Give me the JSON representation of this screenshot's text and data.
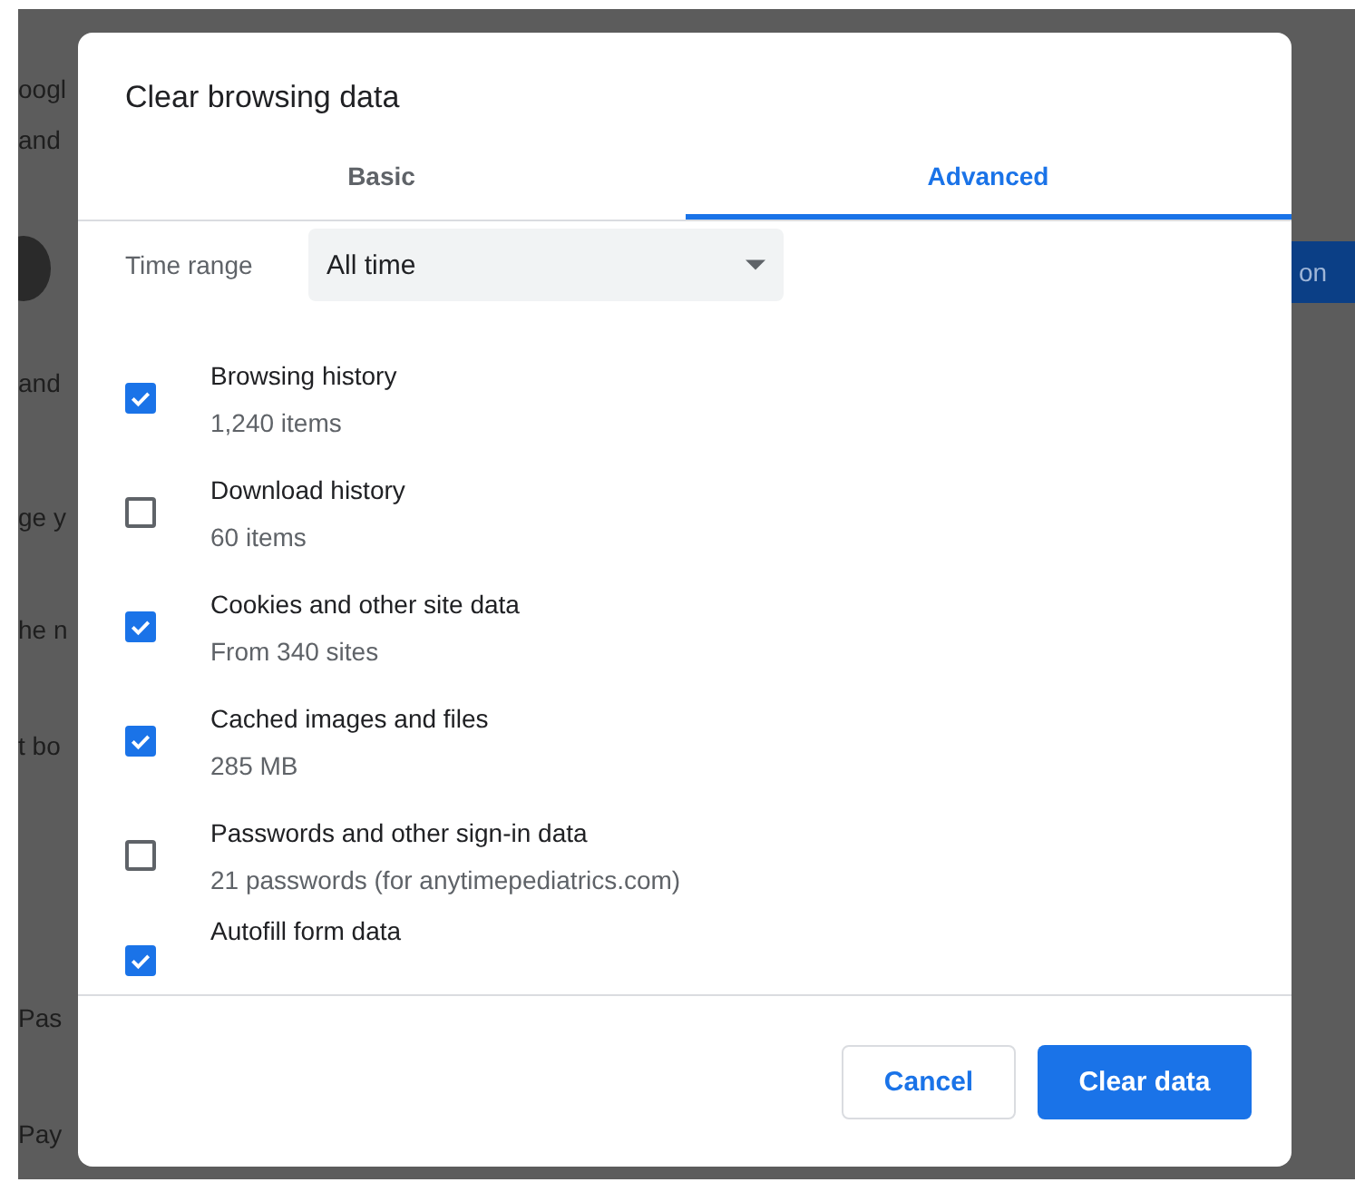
{
  "background": {
    "left_fragments": [
      "oogl",
      "and",
      "and",
      "ge y",
      "he n",
      "t bo",
      "Pas",
      "Pay"
    ],
    "right_button": "on"
  },
  "dialog": {
    "title": "Clear browsing data",
    "tabs": [
      {
        "label": "Basic",
        "selected": false
      },
      {
        "label": "Advanced",
        "selected": true
      }
    ],
    "time_range": {
      "label": "Time range",
      "value": "All time"
    },
    "items": [
      {
        "label": "Browsing history",
        "detail": "1,240 items",
        "checked": true
      },
      {
        "label": "Download history",
        "detail": "60 items",
        "checked": false
      },
      {
        "label": "Cookies and other site data",
        "detail": "From 340 sites",
        "checked": true
      },
      {
        "label": "Cached images and files",
        "detail": "285 MB",
        "checked": true
      },
      {
        "label": "Passwords and other sign-in data",
        "detail": "21 passwords (for anytimepediatrics.com)",
        "checked": false
      },
      {
        "label": "Autofill form data",
        "checked": true
      }
    ],
    "buttons": [
      {
        "label": "Cancel",
        "kind": "secondary"
      },
      {
        "label": "Clear data",
        "kind": "primary"
      }
    ]
  }
}
